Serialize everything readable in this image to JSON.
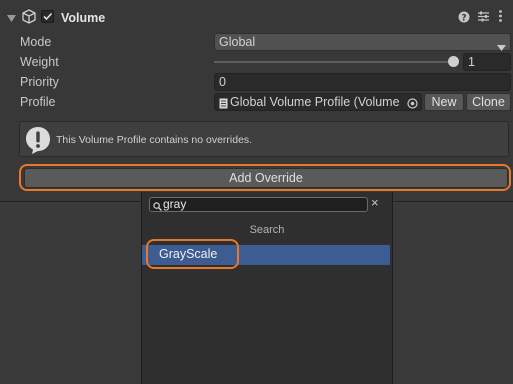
{
  "component": {
    "title": "Volume",
    "enabled": true,
    "icons": [
      "collapse-triangle-icon",
      "cube-icon",
      "checkbox-icon",
      "help-icon",
      "presets-icon",
      "more-menu-icon"
    ]
  },
  "fields": {
    "mode": {
      "label": "Mode",
      "value": "Global"
    },
    "weight": {
      "label": "Weight",
      "value": "1",
      "slider_fraction": 1.0
    },
    "priority": {
      "label": "Priority",
      "value": "0"
    },
    "profile": {
      "label": "Profile",
      "value": "Global Volume Profile (Volume I",
      "new_label": "New",
      "clone_label": "Clone"
    }
  },
  "info": {
    "message": "This Volume Profile contains no overrides."
  },
  "add_override": {
    "label": "Add Override"
  },
  "popup": {
    "search_value": "gray",
    "section_header": "Search",
    "results": [
      {
        "label": "GrayScale",
        "selected": true
      }
    ]
  },
  "colors": {
    "highlight": "#e8772a",
    "selected_row": "#3d5c91",
    "panel": "#383838"
  }
}
